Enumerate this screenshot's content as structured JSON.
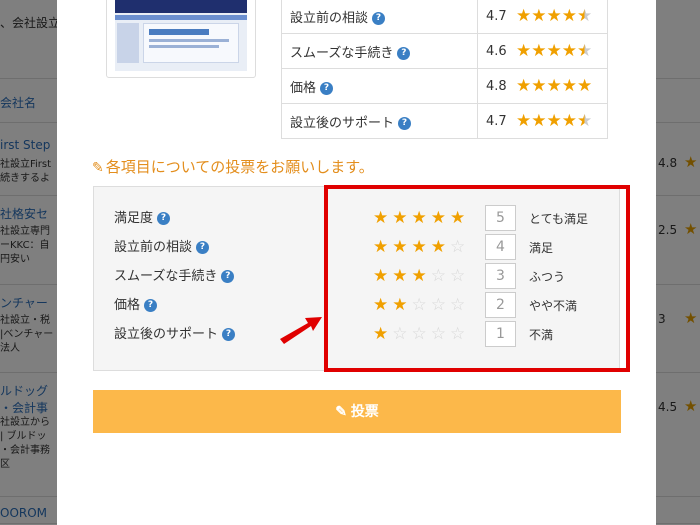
{
  "background": {
    "top_text": "、会社設立",
    "column_header": "会社名",
    "rows": [
      {
        "link": "irst Step",
        "desc": "社設立First\n続きするよ",
        "score": "4.8",
        "star": "★"
      },
      {
        "link": "社格安セ",
        "desc": "社設立専門\nーKKC：自\n円安い",
        "score": "2.5",
        "star": "★"
      },
      {
        "link": "ンチャー",
        "desc": "社設立・税\n|ベンチャー\n法人",
        "score": "3",
        "star": "★"
      },
      {
        "link": "ルドッグ\n・会計事",
        "desc": "社設立から\n| ブルドッ\n・会計事務\n区",
        "score": "4.5",
        "star": "★"
      },
      {
        "link": "OOROM",
        "desc": "",
        "score": "",
        "star": ""
      }
    ]
  },
  "summary": [
    {
      "label": "設立前の相談",
      "score": "4.7",
      "stars": [
        "full",
        "full",
        "full",
        "full",
        "half"
      ]
    },
    {
      "label": "スムーズな手続き",
      "score": "4.6",
      "stars": [
        "full",
        "full",
        "full",
        "full",
        "half"
      ]
    },
    {
      "label": "価格",
      "score": "4.8",
      "stars": [
        "full",
        "full",
        "full",
        "full",
        "full"
      ]
    },
    {
      "label": "設立後のサポート",
      "score": "4.7",
      "stars": [
        "full",
        "full",
        "full",
        "full",
        "half"
      ]
    }
  ],
  "help_icon": "?",
  "prompt": {
    "icon": "pencil-square-icon",
    "text": "各項目についての投票をお願いします。"
  },
  "vote_items": [
    "満足度",
    "設立前の相談",
    "スムーズな手続き",
    "価格",
    "設立後のサポート"
  ],
  "scale": [
    {
      "value": "5",
      "filled": 5,
      "label": "とても満足"
    },
    {
      "value": "4",
      "filled": 4,
      "label": "満足"
    },
    {
      "value": "3",
      "filled": 3,
      "label": "ふつう"
    },
    {
      "value": "2",
      "filled": 2,
      "label": "やや不満"
    },
    {
      "value": "1",
      "filled": 1,
      "label": "不満"
    }
  ],
  "submit": {
    "icon": "pencil-square-icon",
    "label": "投票"
  },
  "colors": {
    "accent": "#fcb84a",
    "prompt": "#e38e1d",
    "star": "#f0a000",
    "highlight": "#e00000",
    "help": "#3a7fc4"
  }
}
